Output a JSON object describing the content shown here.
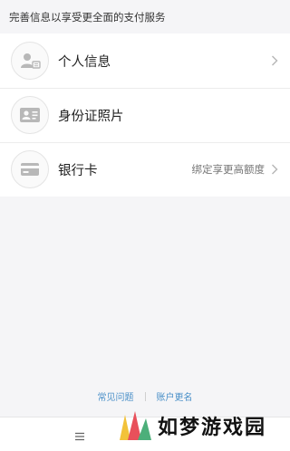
{
  "header": {
    "note": "完善信息以享受更全面的支付服务"
  },
  "items": [
    {
      "label": "个人信息",
      "right_text": ""
    },
    {
      "label": "身份证照片",
      "right_text": ""
    },
    {
      "label": "银行卡",
      "right_text": "绑定享更高额度"
    }
  ],
  "footer": {
    "faq": "常见问题",
    "rename": "账户更名"
  },
  "watermark": {
    "text": "如梦游戏园"
  },
  "colors": {
    "link": "#4a90c8",
    "icon": "#b8b8b8"
  }
}
